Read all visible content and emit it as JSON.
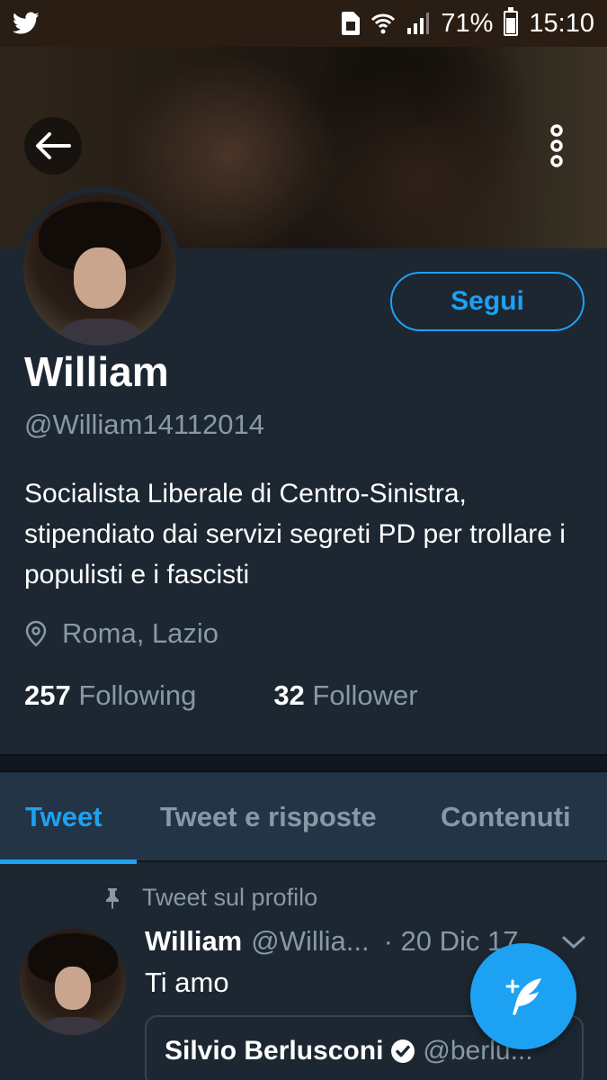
{
  "status_bar": {
    "battery_percent": "71%",
    "time": "15:10",
    "icons": [
      "twitter-icon",
      "sim-icon",
      "wifi-icon",
      "signal-icon",
      "battery-icon"
    ]
  },
  "header": {
    "back_icon": "arrow-left-icon",
    "menu_icon": "vertical-dots-icon"
  },
  "profile": {
    "follow_label": "Segui",
    "name": "William",
    "handle": "@William14112014",
    "bio": "Socialista Liberale di Centro-Sinistra, stipendiato dai servizi segreti PD per trollare i populisti e i fascisti",
    "location": "Roma, Lazio",
    "following_count": "257",
    "following_label": "Following",
    "followers_count": "32",
    "followers_label": "Follower"
  },
  "tabs": [
    {
      "label": "Tweet",
      "active": true
    },
    {
      "label": "Tweet e risposte",
      "active": false
    },
    {
      "label": "Contenuti",
      "active": false
    }
  ],
  "tweet": {
    "pinned_label": "Tweet sul profilo",
    "name": "William",
    "handle": "@Willia...",
    "date": "· 20 Dic 17",
    "text": "Ti amo",
    "quoted": {
      "name": "Silvio Berlusconi",
      "handle": "@berlu..."
    }
  },
  "colors": {
    "accent": "#1da1f2",
    "background": "#1c2732",
    "secondary_text": "#8899a6"
  }
}
